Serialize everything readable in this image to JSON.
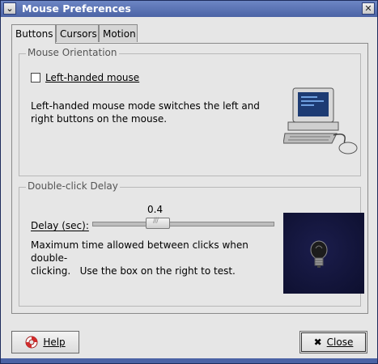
{
  "window": {
    "title": "Mouse Preferences",
    "menu_icon": "chevron-down-icon",
    "close_icon": "close-icon"
  },
  "tabs": [
    {
      "label": "Buttons",
      "active": true
    },
    {
      "label": "Cursors",
      "active": false
    },
    {
      "label": "Motion",
      "active": false
    }
  ],
  "orientation": {
    "section_label": "Mouse Orientation",
    "checkbox_label": "Left-handed mouse",
    "checked": false,
    "description_line1": "Left-handed mouse mode switches the left and",
    "description_line2": "right buttons on the mouse.",
    "icon": "computer-mouse-icon"
  },
  "double_click": {
    "section_label": "Double-click Delay",
    "delay_label": "Delay (sec):",
    "value": "0.4",
    "description_line1": "Maximum time allowed between clicks when double-",
    "description_line2": "clicking.   Use the box on the right to test.",
    "test_icon": "lightbulb-icon"
  },
  "buttons": {
    "help_label": "Help",
    "close_label": "Close",
    "help_icon": "lifebuoy-icon",
    "close_icon": "close-x-icon"
  }
}
